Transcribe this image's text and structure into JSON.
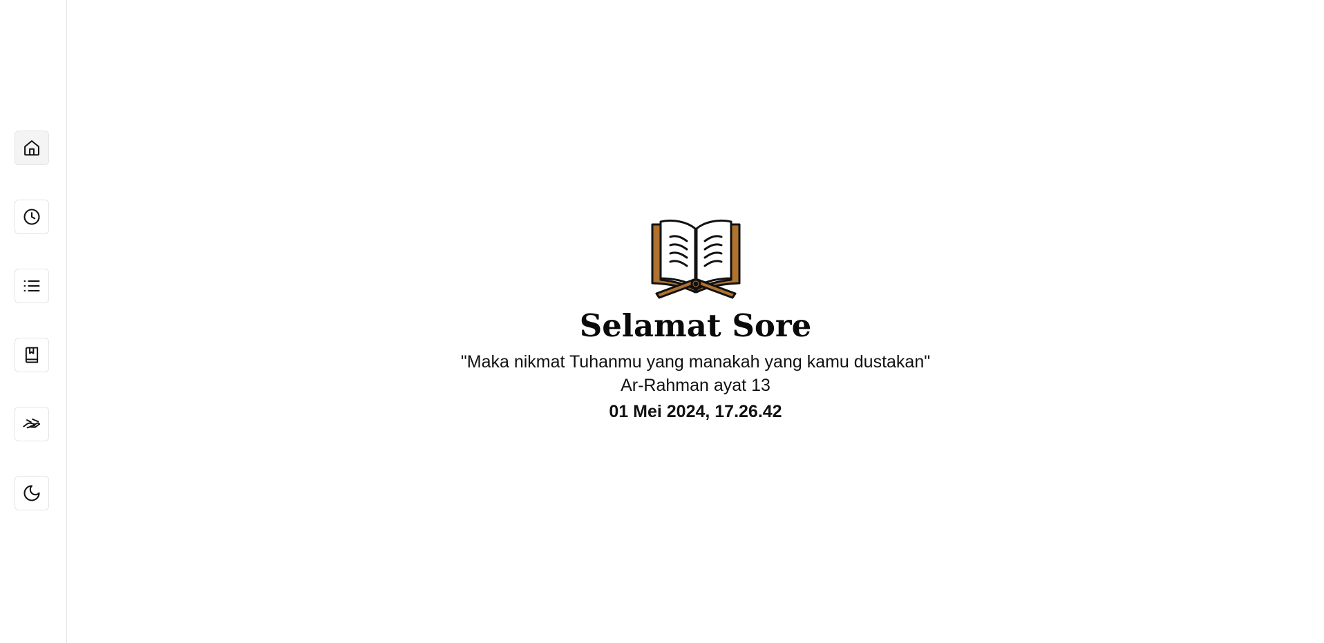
{
  "sidebar": {
    "items": [
      {
        "icon": "home-icon",
        "active": true
      },
      {
        "icon": "clock-icon",
        "active": false
      },
      {
        "icon": "list-icon",
        "active": false
      },
      {
        "icon": "bookmark-book-icon",
        "active": false
      },
      {
        "icon": "hand-giving-icon",
        "active": false
      },
      {
        "icon": "moon-icon",
        "active": false
      }
    ]
  },
  "hero": {
    "icon": "open-quran-book-icon",
    "greeting": "Selamat Sore",
    "verse": "\"Maka nikmat Tuhanmu yang manakah yang kamu dustakan\"",
    "verse_ref": "Ar-Rahman ayat 13",
    "datetime": "01 Mei 2024, 17.26.42"
  },
  "colors": {
    "book_cover": "#b0722f",
    "outline": "#111111",
    "border": "#e4e4e7",
    "active_bg": "#f4f4f5"
  }
}
